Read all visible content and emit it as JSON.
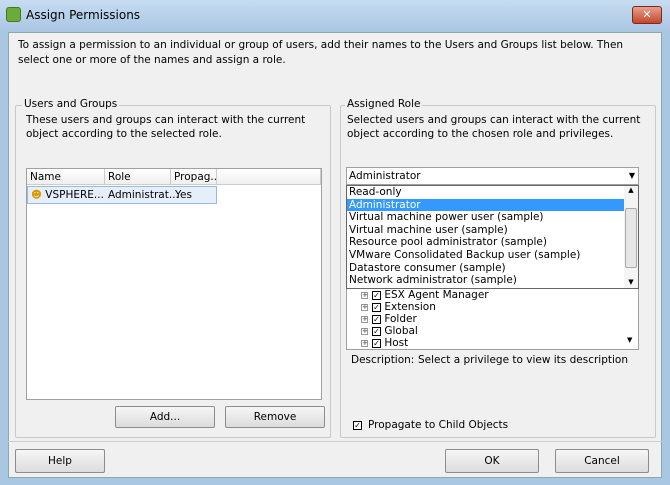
{
  "window": {
    "title": "Assign Permissions",
    "close": "✕"
  },
  "intro": "To assign a permission to an individual or group of users, add their names to the Users and Groups list below. Then select one or more of the names and assign a role.",
  "users": {
    "title": "Users and Groups",
    "description": "These users and groups can interact with the current object according to the selected role.",
    "columns": [
      "Name",
      "Role",
      "Propag..."
    ],
    "rows": [
      {
        "name": "VSPHERE...",
        "role": "Administrat...",
        "propagate": "Yes"
      }
    ],
    "add": "Add...",
    "remove": "Remove"
  },
  "role": {
    "title": "Assigned Role",
    "description": "Selected users and groups can interact with the current object according to the chosen role and privileges.",
    "selected": "Administrator",
    "options": [
      "Read-only",
      "Administrator",
      "Virtual machine power user (sample)",
      "Virtual machine user (sample)",
      "Resource pool administrator (sample)",
      "VMware Consolidated Backup user (sample)",
      "Datastore consumer (sample)",
      "Network administrator (sample)"
    ],
    "tree": [
      "ESX Agent Manager",
      "Extension",
      "Folder",
      "Global",
      "Host"
    ],
    "desc_label": "Description:",
    "desc_value": "Select a privilege to view its description",
    "propagate": "Propagate to Child Objects"
  },
  "footer": {
    "help": "Help",
    "ok": "OK",
    "cancel": "Cancel"
  }
}
